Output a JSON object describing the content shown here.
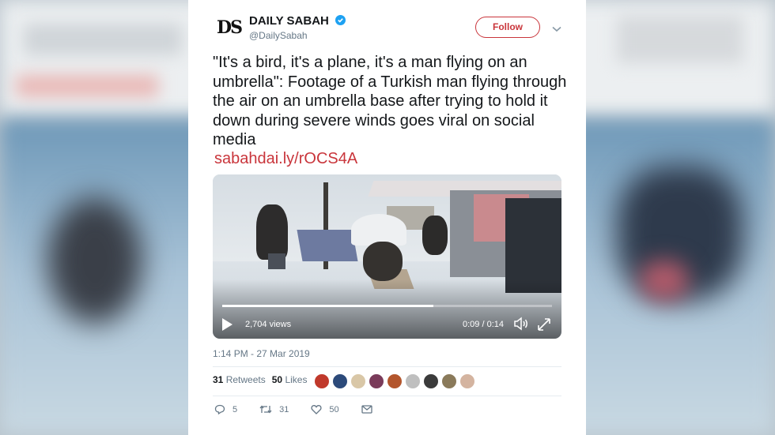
{
  "account": {
    "logo_text": "DS",
    "name": "DAILY SABAH",
    "handle": "@DailySabah",
    "follow_label": "Follow"
  },
  "tweet": {
    "text": "\"It's a bird, it's a plane, it's a man flying on an umbrella\": Footage of a Turkish man flying through the air on an umbrella base after trying to hold it down during severe winds goes viral on social media",
    "link": "sabahdai.ly/rOCS4A",
    "timestamp": "1:14 PM - 27 Mar 2019"
  },
  "video": {
    "views": "2,704 views",
    "time": "0:09 / 0:14",
    "progress": 0.64
  },
  "stats": {
    "retweets_count": "31",
    "retweets_label": "Retweets",
    "likes_count": "50",
    "likes_label": "Likes"
  },
  "liker_avatar_colors": [
    "#c0392b",
    "#2c4a7a",
    "#d9c7a7",
    "#7a3b5a",
    "#b3552c",
    "#bfbfbf",
    "#3b3b3b",
    "#8a7a5a",
    "#d4b4a0"
  ],
  "actions": {
    "replies": "5",
    "retweets": "31",
    "likes": "50"
  },
  "colors": {
    "brand_red": "#c9353b",
    "verified_blue": "#1da1f2",
    "muted_text": "#657786"
  }
}
